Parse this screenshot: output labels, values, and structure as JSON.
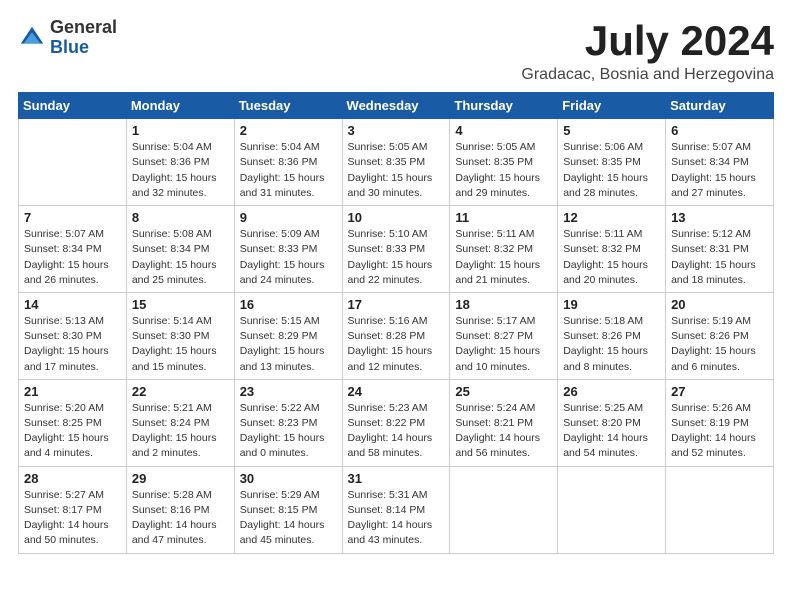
{
  "logo": {
    "general": "General",
    "blue": "Blue"
  },
  "title": "July 2024",
  "location": "Gradacac, Bosnia and Herzegovina",
  "weekdays": [
    "Sunday",
    "Monday",
    "Tuesday",
    "Wednesday",
    "Thursday",
    "Friday",
    "Saturday"
  ],
  "weeks": [
    [
      {
        "day": "",
        "info": ""
      },
      {
        "day": "1",
        "info": "Sunrise: 5:04 AM\nSunset: 8:36 PM\nDaylight: 15 hours\nand 32 minutes."
      },
      {
        "day": "2",
        "info": "Sunrise: 5:04 AM\nSunset: 8:36 PM\nDaylight: 15 hours\nand 31 minutes."
      },
      {
        "day": "3",
        "info": "Sunrise: 5:05 AM\nSunset: 8:35 PM\nDaylight: 15 hours\nand 30 minutes."
      },
      {
        "day": "4",
        "info": "Sunrise: 5:05 AM\nSunset: 8:35 PM\nDaylight: 15 hours\nand 29 minutes."
      },
      {
        "day": "5",
        "info": "Sunrise: 5:06 AM\nSunset: 8:35 PM\nDaylight: 15 hours\nand 28 minutes."
      },
      {
        "day": "6",
        "info": "Sunrise: 5:07 AM\nSunset: 8:34 PM\nDaylight: 15 hours\nand 27 minutes."
      }
    ],
    [
      {
        "day": "7",
        "info": "Sunrise: 5:07 AM\nSunset: 8:34 PM\nDaylight: 15 hours\nand 26 minutes."
      },
      {
        "day": "8",
        "info": "Sunrise: 5:08 AM\nSunset: 8:34 PM\nDaylight: 15 hours\nand 25 minutes."
      },
      {
        "day": "9",
        "info": "Sunrise: 5:09 AM\nSunset: 8:33 PM\nDaylight: 15 hours\nand 24 minutes."
      },
      {
        "day": "10",
        "info": "Sunrise: 5:10 AM\nSunset: 8:33 PM\nDaylight: 15 hours\nand 22 minutes."
      },
      {
        "day": "11",
        "info": "Sunrise: 5:11 AM\nSunset: 8:32 PM\nDaylight: 15 hours\nand 21 minutes."
      },
      {
        "day": "12",
        "info": "Sunrise: 5:11 AM\nSunset: 8:32 PM\nDaylight: 15 hours\nand 20 minutes."
      },
      {
        "day": "13",
        "info": "Sunrise: 5:12 AM\nSunset: 8:31 PM\nDaylight: 15 hours\nand 18 minutes."
      }
    ],
    [
      {
        "day": "14",
        "info": "Sunrise: 5:13 AM\nSunset: 8:30 PM\nDaylight: 15 hours\nand 17 minutes."
      },
      {
        "day": "15",
        "info": "Sunrise: 5:14 AM\nSunset: 8:30 PM\nDaylight: 15 hours\nand 15 minutes."
      },
      {
        "day": "16",
        "info": "Sunrise: 5:15 AM\nSunset: 8:29 PM\nDaylight: 15 hours\nand 13 minutes."
      },
      {
        "day": "17",
        "info": "Sunrise: 5:16 AM\nSunset: 8:28 PM\nDaylight: 15 hours\nand 12 minutes."
      },
      {
        "day": "18",
        "info": "Sunrise: 5:17 AM\nSunset: 8:27 PM\nDaylight: 15 hours\nand 10 minutes."
      },
      {
        "day": "19",
        "info": "Sunrise: 5:18 AM\nSunset: 8:26 PM\nDaylight: 15 hours\nand 8 minutes."
      },
      {
        "day": "20",
        "info": "Sunrise: 5:19 AM\nSunset: 8:26 PM\nDaylight: 15 hours\nand 6 minutes."
      }
    ],
    [
      {
        "day": "21",
        "info": "Sunrise: 5:20 AM\nSunset: 8:25 PM\nDaylight: 15 hours\nand 4 minutes."
      },
      {
        "day": "22",
        "info": "Sunrise: 5:21 AM\nSunset: 8:24 PM\nDaylight: 15 hours\nand 2 minutes."
      },
      {
        "day": "23",
        "info": "Sunrise: 5:22 AM\nSunset: 8:23 PM\nDaylight: 15 hours\nand 0 minutes."
      },
      {
        "day": "24",
        "info": "Sunrise: 5:23 AM\nSunset: 8:22 PM\nDaylight: 14 hours\nand 58 minutes."
      },
      {
        "day": "25",
        "info": "Sunrise: 5:24 AM\nSunset: 8:21 PM\nDaylight: 14 hours\nand 56 minutes."
      },
      {
        "day": "26",
        "info": "Sunrise: 5:25 AM\nSunset: 8:20 PM\nDaylight: 14 hours\nand 54 minutes."
      },
      {
        "day": "27",
        "info": "Sunrise: 5:26 AM\nSunset: 8:19 PM\nDaylight: 14 hours\nand 52 minutes."
      }
    ],
    [
      {
        "day": "28",
        "info": "Sunrise: 5:27 AM\nSunset: 8:17 PM\nDaylight: 14 hours\nand 50 minutes."
      },
      {
        "day": "29",
        "info": "Sunrise: 5:28 AM\nSunset: 8:16 PM\nDaylight: 14 hours\nand 47 minutes."
      },
      {
        "day": "30",
        "info": "Sunrise: 5:29 AM\nSunset: 8:15 PM\nDaylight: 14 hours\nand 45 minutes."
      },
      {
        "day": "31",
        "info": "Sunrise: 5:31 AM\nSunset: 8:14 PM\nDaylight: 14 hours\nand 43 minutes."
      },
      {
        "day": "",
        "info": ""
      },
      {
        "day": "",
        "info": ""
      },
      {
        "day": "",
        "info": ""
      }
    ]
  ]
}
